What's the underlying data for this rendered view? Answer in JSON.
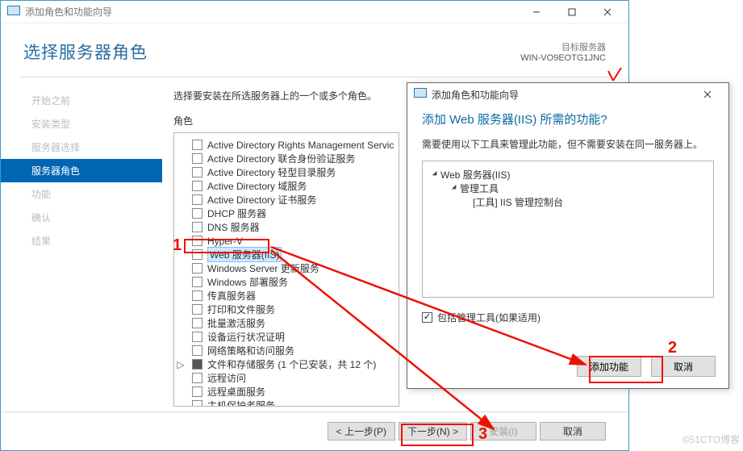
{
  "window": {
    "title": "添加角色和功能向导",
    "heading": "选择服务器角色",
    "dest_label": "目标服务器",
    "dest_value": "WIN-VO9EOTG1JNC",
    "instruction": "选择要安装在所选服务器上的一个或多个角色。",
    "roles_label": "角色"
  },
  "nav": {
    "items": [
      {
        "label": "开始之前"
      },
      {
        "label": "安装类型"
      },
      {
        "label": "服务器选择"
      },
      {
        "label": "服务器角色",
        "active": true
      },
      {
        "label": "功能"
      },
      {
        "label": "确认"
      },
      {
        "label": "结果"
      }
    ]
  },
  "roles": [
    {
      "label": "Active Directory Rights Management Servic"
    },
    {
      "label": "Active Directory 联合身份验证服务"
    },
    {
      "label": "Active Directory 轻型目录服务"
    },
    {
      "label": "Active Directory 域服务"
    },
    {
      "label": "Active Directory 证书服务"
    },
    {
      "label": "DHCP 服务器"
    },
    {
      "label": "DNS 服务器"
    },
    {
      "label": "Hyper-V"
    },
    {
      "label": "Web 服务器(IIS)",
      "selected": true
    },
    {
      "label": "Windows Server 更新服务"
    },
    {
      "label": "Windows 部署服务"
    },
    {
      "label": "传真服务器"
    },
    {
      "label": "打印和文件服务"
    },
    {
      "label": "批量激活服务"
    },
    {
      "label": "设备运行状况证明"
    },
    {
      "label": "网络策略和访问服务"
    },
    {
      "label": "文件和存储服务 (1 个已安装，共 12 个)",
      "expand": true,
      "filled": true
    },
    {
      "label": "远程访问"
    },
    {
      "label": "远程桌面服务"
    },
    {
      "label": "主机保护者服务"
    }
  ],
  "footer": {
    "prev": "< 上一步(P)",
    "next": "下一步(N) >",
    "install": "安装(I)",
    "cancel": "取消"
  },
  "popup": {
    "title": "添加角色和功能向导",
    "heading": "添加 Web 服务器(IIS) 所需的功能?",
    "desc": "需要使用以下工具来管理此功能，但不需要安装在同一服务器上。",
    "tree": {
      "l1": "Web 服务器(IIS)",
      "l2": "管理工具",
      "l3": "[工具] IIS 管理控制台"
    },
    "include_label": "包括管理工具(如果适用)",
    "add": "添加功能",
    "cancel": "取消"
  },
  "anno": {
    "n1": "1",
    "n2": "2",
    "n3": "3"
  },
  "watermark": "©51CTO博客"
}
